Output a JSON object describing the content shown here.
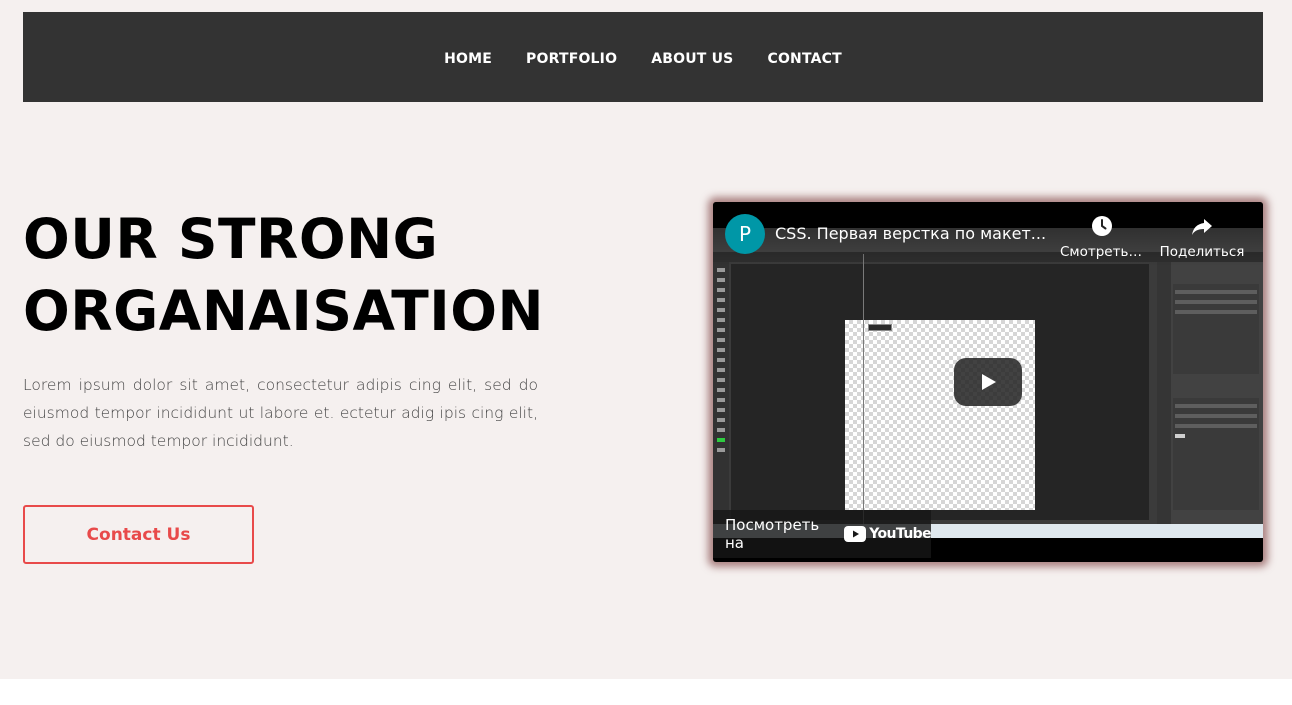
{
  "nav": {
    "items": [
      {
        "label": "HOME"
      },
      {
        "label": "PORTFOLIO"
      },
      {
        "label": "ABOUT US"
      },
      {
        "label": "CONTACT"
      }
    ]
  },
  "hero": {
    "title_line1": "OUR STRONG",
    "title_line2": "ORGANAISATION",
    "text": "Lorem ipsum dolor sit amet, consectetur adipis cing elit, sed do eiusmod tempor incididunt ut labore et. ectetur adig ipis cing elit, sed do eiusmod tempor incididunt.",
    "button_label": "Contact Us"
  },
  "video": {
    "channel_initial": "P",
    "title": "CSS. Первая верстка по макет...",
    "watch_later_label": "Смотреть ...",
    "share_label": "Поделиться",
    "watch_on_label": "Посмотреть на",
    "youtube_label": "YouTube",
    "icons": {
      "clock": "clock-icon",
      "share": "share-icon",
      "play": "play-icon",
      "youtube": "youtube-logo-icon"
    }
  },
  "colors": {
    "page_bg": "#f5f0ef",
    "nav_bg": "#333333",
    "accent": "#e84a4a",
    "avatar": "#0097a7"
  }
}
